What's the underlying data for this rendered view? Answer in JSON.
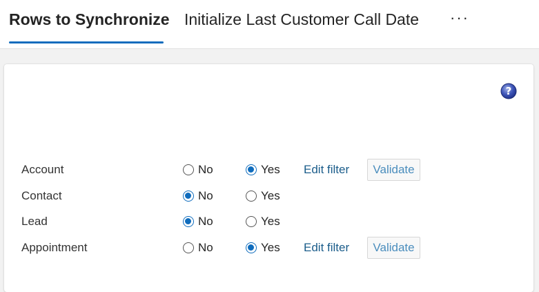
{
  "tabs": {
    "active": "Rows to Synchronize",
    "second": "Initialize Last Customer Call Date",
    "more": "···"
  },
  "help": {
    "icon": "help-icon"
  },
  "rows": [
    {
      "label": "Account",
      "no": "No",
      "yes": "Yes",
      "selected": "Yes",
      "edit_filter": "Edit filter",
      "validate": "Validate"
    },
    {
      "label": "Contact",
      "no": "No",
      "yes": "Yes",
      "selected": "No"
    },
    {
      "label": "Lead",
      "no": "No",
      "yes": "Yes",
      "selected": "No"
    },
    {
      "label": "Appointment",
      "no": "No",
      "yes": "Yes",
      "selected": "Yes",
      "edit_filter": "Edit filter",
      "validate": "Validate"
    }
  ],
  "colors": {
    "accent": "#0f6cbd",
    "link": "#1a5c8a",
    "validate_text": "#4a8dbd"
  }
}
